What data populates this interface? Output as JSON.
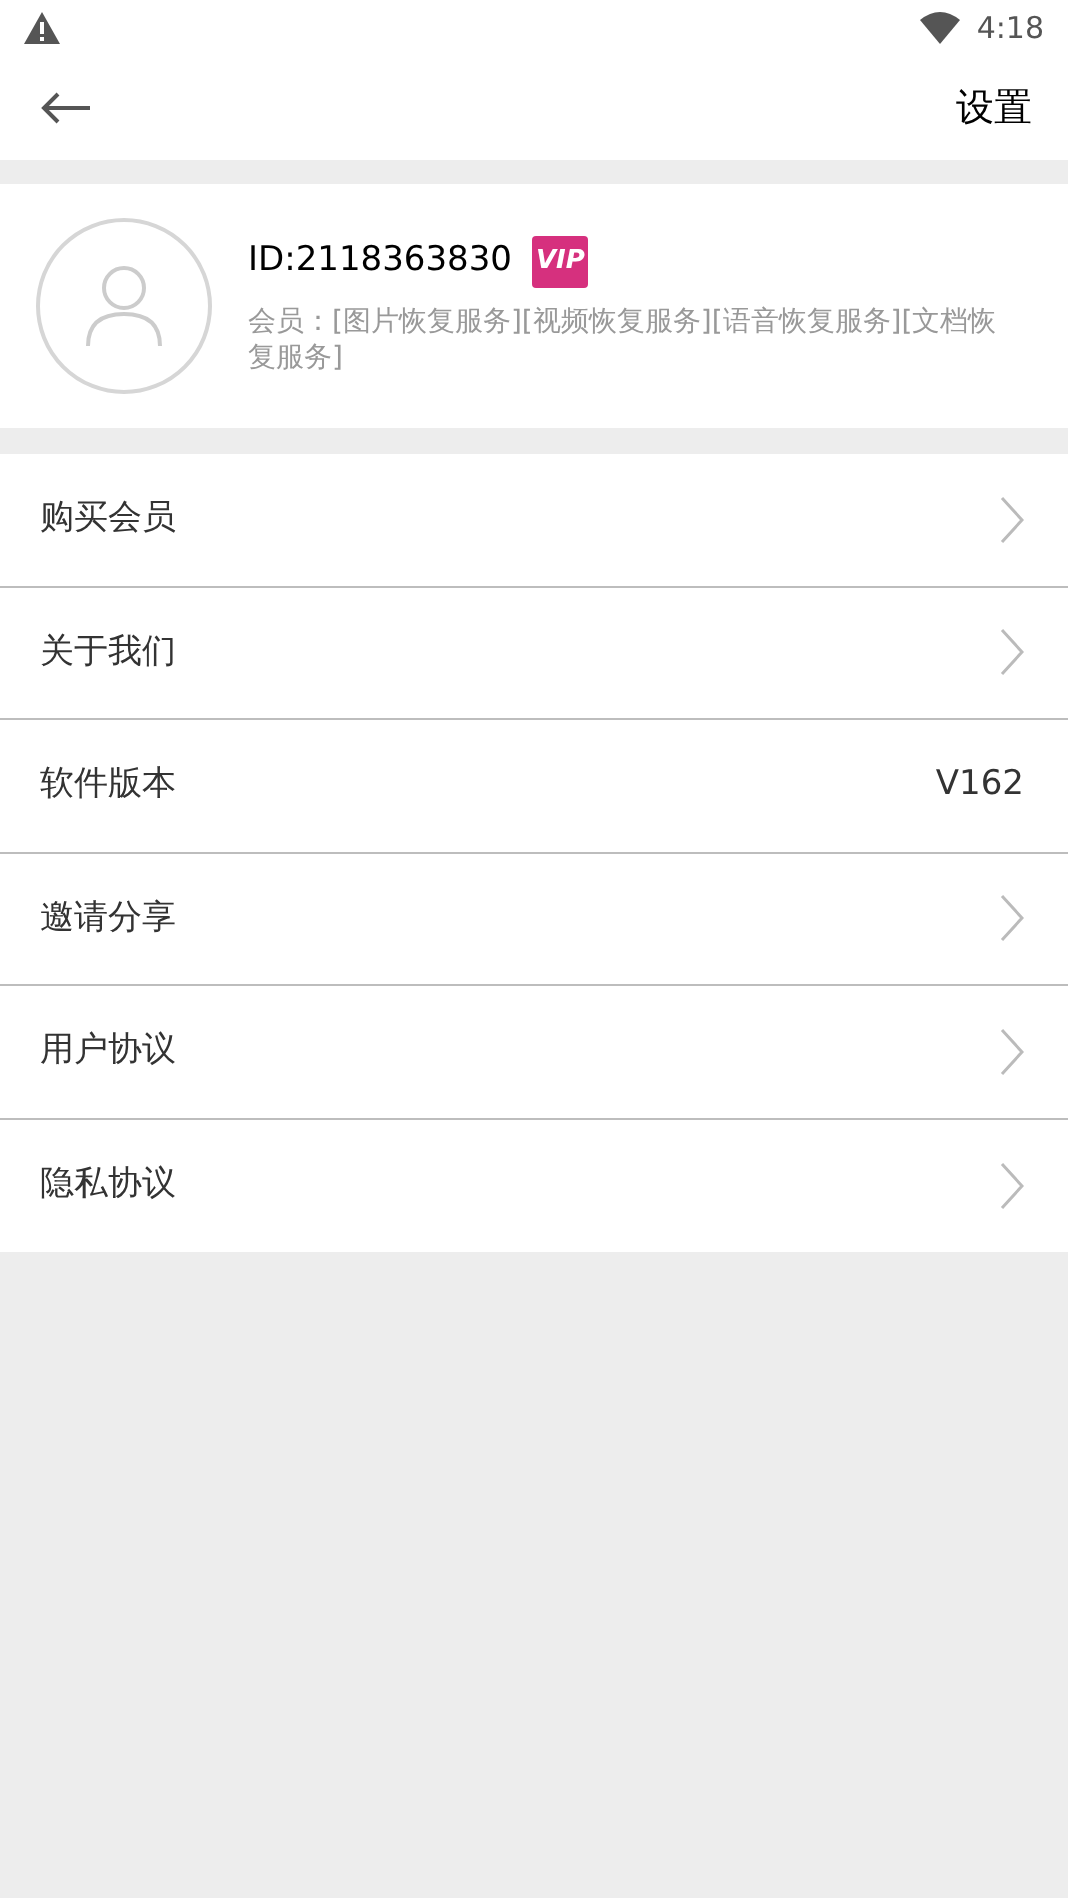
{
  "status_bar": {
    "time": "4:18"
  },
  "toolbar": {
    "title": "设置"
  },
  "profile": {
    "id": "ID:2118363830",
    "badge": "VIP",
    "membership": "会员：[图片恢复服务][视频恢复服务][语音恢复服务][文档恢复服务]"
  },
  "menu": [
    {
      "label": "购买会员",
      "kind": "link"
    },
    {
      "label": "关于我们",
      "kind": "link"
    },
    {
      "label": "软件版本",
      "kind": "value",
      "value": "V162"
    },
    {
      "label": "邀请分享",
      "kind": "link"
    },
    {
      "label": "用户协议",
      "kind": "link"
    },
    {
      "label": "隐私协议",
      "kind": "link"
    }
  ]
}
